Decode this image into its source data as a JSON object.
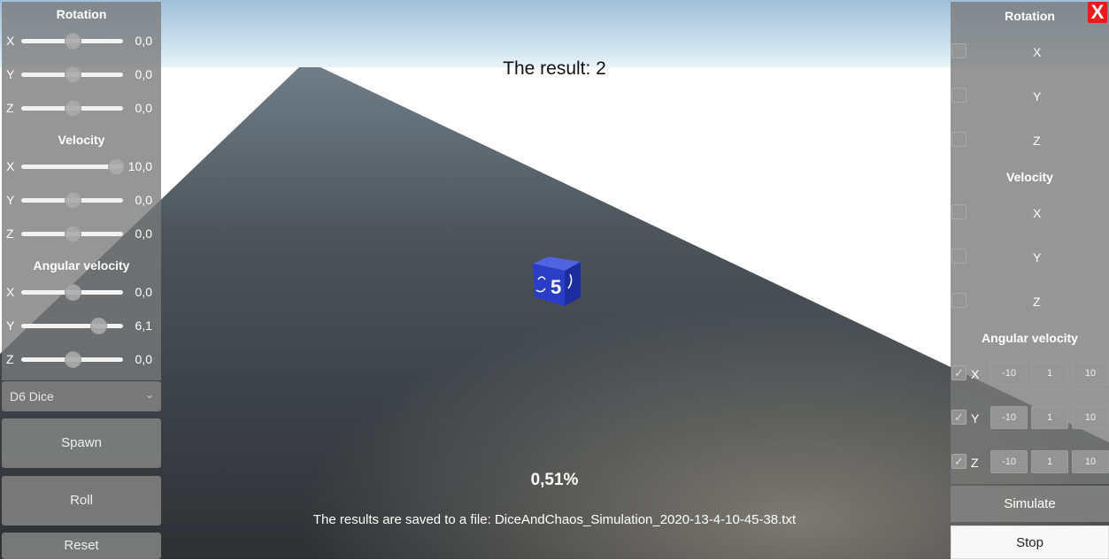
{
  "scene": {
    "result_text": "The result: 2",
    "progress_text": "0,51%",
    "saved_text": "The results are saved to a file: DiceAndChaos_Simulation_2020-13-4-10-45-38.txt",
    "dice_visible_number": "5"
  },
  "left_panel": {
    "sections": [
      {
        "title": "Rotation",
        "rows": [
          {
            "axis": "X",
            "value": "0,0",
            "fraction": 0.5
          },
          {
            "axis": "Y",
            "value": "0,0",
            "fraction": 0.5
          },
          {
            "axis": "Z",
            "value": "0,0",
            "fraction": 0.5
          }
        ]
      },
      {
        "title": "Velocity",
        "rows": [
          {
            "axis": "X",
            "value": "10,0",
            "fraction": 1.0
          },
          {
            "axis": "Y",
            "value": "0,0",
            "fraction": 0.5
          },
          {
            "axis": "Z",
            "value": "0,0",
            "fraction": 0.5
          }
        ]
      },
      {
        "title": "Angular velocity",
        "rows": [
          {
            "axis": "X",
            "value": "0,0",
            "fraction": 0.5
          },
          {
            "axis": "Y",
            "value": "6,1",
            "fraction": 0.8
          },
          {
            "axis": "Z",
            "value": "0,0",
            "fraction": 0.5
          }
        ]
      }
    ],
    "dice_select": "D6 Dice",
    "spawn_label": "Spawn",
    "roll_label": "Roll",
    "reset_label": "Reset"
  },
  "right_panel": {
    "rotation_title": "Rotation",
    "rotation_axes": [
      "X",
      "Y",
      "Z"
    ],
    "velocity_title": "Velocity",
    "velocity_axes": [
      "X",
      "Y",
      "Z"
    ],
    "angular_title": "Angular velocity",
    "angular_rows": [
      {
        "axis": "X",
        "checked": true,
        "min": "-10",
        "step": "1",
        "max": "10"
      },
      {
        "axis": "Y",
        "checked": true,
        "min": "-10",
        "step": "1",
        "max": "10"
      },
      {
        "axis": "Z",
        "checked": true,
        "min": "-10",
        "step": "1",
        "max": "10"
      }
    ],
    "simulate_label": "Simulate",
    "stop_label": "Stop",
    "close_label": "X"
  },
  "colors": {
    "close": "#e81b1b",
    "dice": "#2437c8"
  }
}
